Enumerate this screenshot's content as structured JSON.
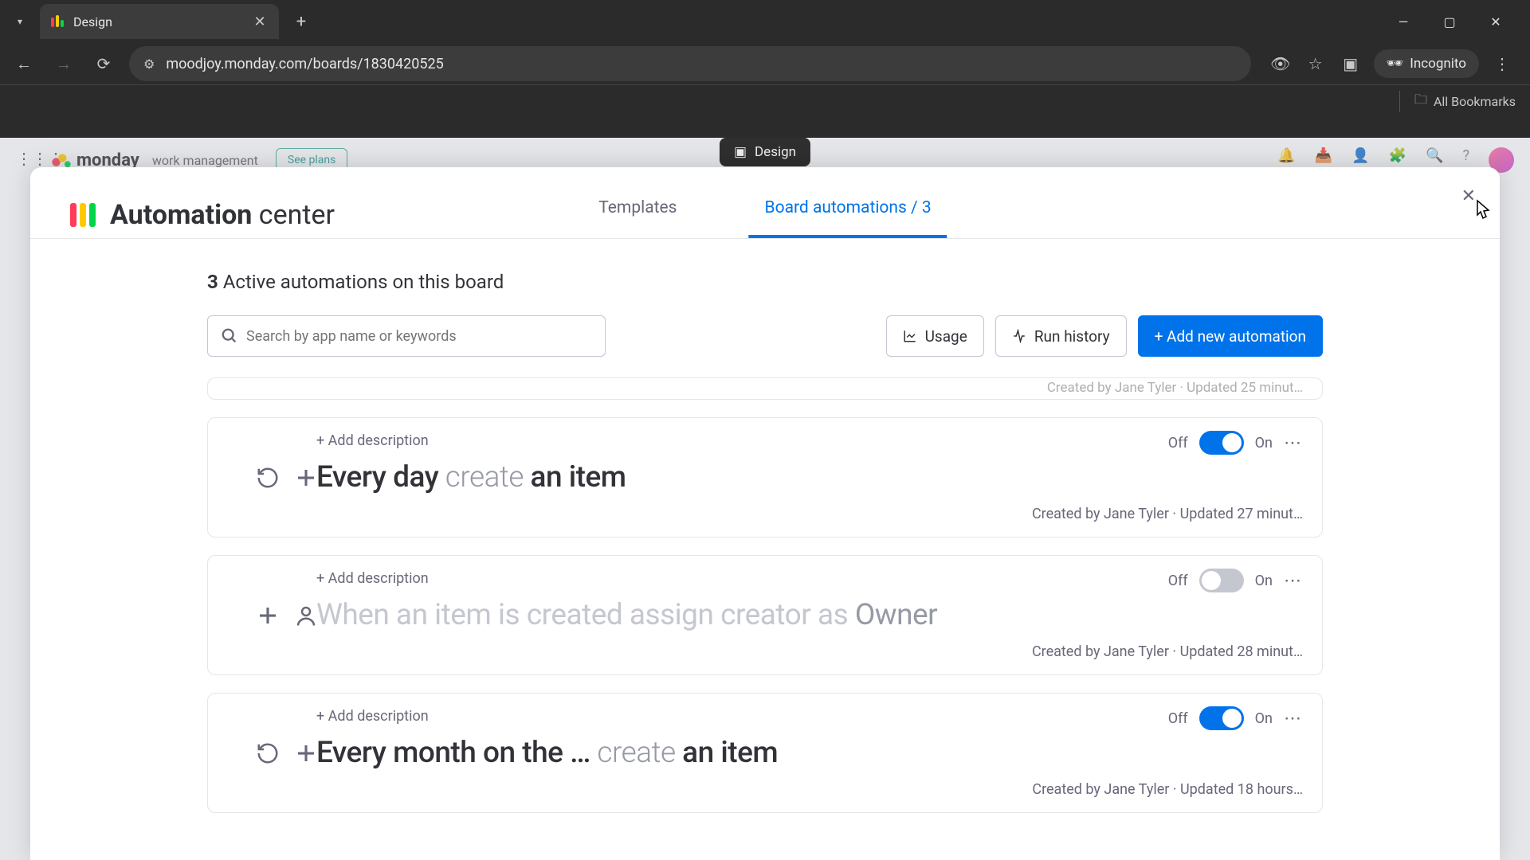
{
  "browser": {
    "tab_title": "Design",
    "url": "moodjoy.monday.com/boards/1830420525",
    "incognito_label": "Incognito",
    "all_bookmarks": "All Bookmarks"
  },
  "app": {
    "bg_tab_label": "Design",
    "header_product": "monday",
    "header_sub": "work management",
    "see_plans": "See plans"
  },
  "modal": {
    "title_bold": "Automation",
    "title_light": "center",
    "tabs": {
      "templates": "Templates",
      "board_automations": "Board automations / 3"
    },
    "summary_count": "3",
    "summary_text": "Active automations on this board",
    "search_placeholder": "Search by app name or keywords",
    "usage_btn": "Usage",
    "run_history_btn": "Run history",
    "add_btn": "+ Add new automation",
    "peek_meta": "Created by Jane Tyler · Updated 25 minut…",
    "automations": [
      {
        "add_desc": "+ Add description",
        "icon1": "refresh",
        "icon2": "plus",
        "recipe_parts": [
          {
            "t": "Every day",
            "cls": "bold"
          },
          {
            "t": " create ",
            "cls": "light"
          },
          {
            "t": "an item",
            "cls": "bold"
          }
        ],
        "off": "Off",
        "on": "On",
        "enabled": true,
        "meta": "Created by Jane Tyler · Updated 27 minut…"
      },
      {
        "add_desc": "+ Add description",
        "icon1": "plus",
        "icon2": "person",
        "recipe_parts": [
          {
            "t": "When an item is created assign creator as ",
            "cls": ""
          },
          {
            "t": "Owner",
            "cls": "highlight"
          }
        ],
        "off": "Off",
        "on": "On",
        "enabled": false,
        "meta": "Created by Jane Tyler · Updated 28 minut…"
      },
      {
        "add_desc": "+ Add description",
        "icon1": "refresh",
        "icon2": "plus",
        "recipe_parts": [
          {
            "t": "Every month on the …",
            "cls": "bold"
          },
          {
            "t": "  create ",
            "cls": "light"
          },
          {
            "t": "an item",
            "cls": "bold"
          }
        ],
        "off": "Off",
        "on": "On",
        "enabled": true,
        "meta": "Created by Jane Tyler · Updated 18 hours…"
      }
    ]
  }
}
